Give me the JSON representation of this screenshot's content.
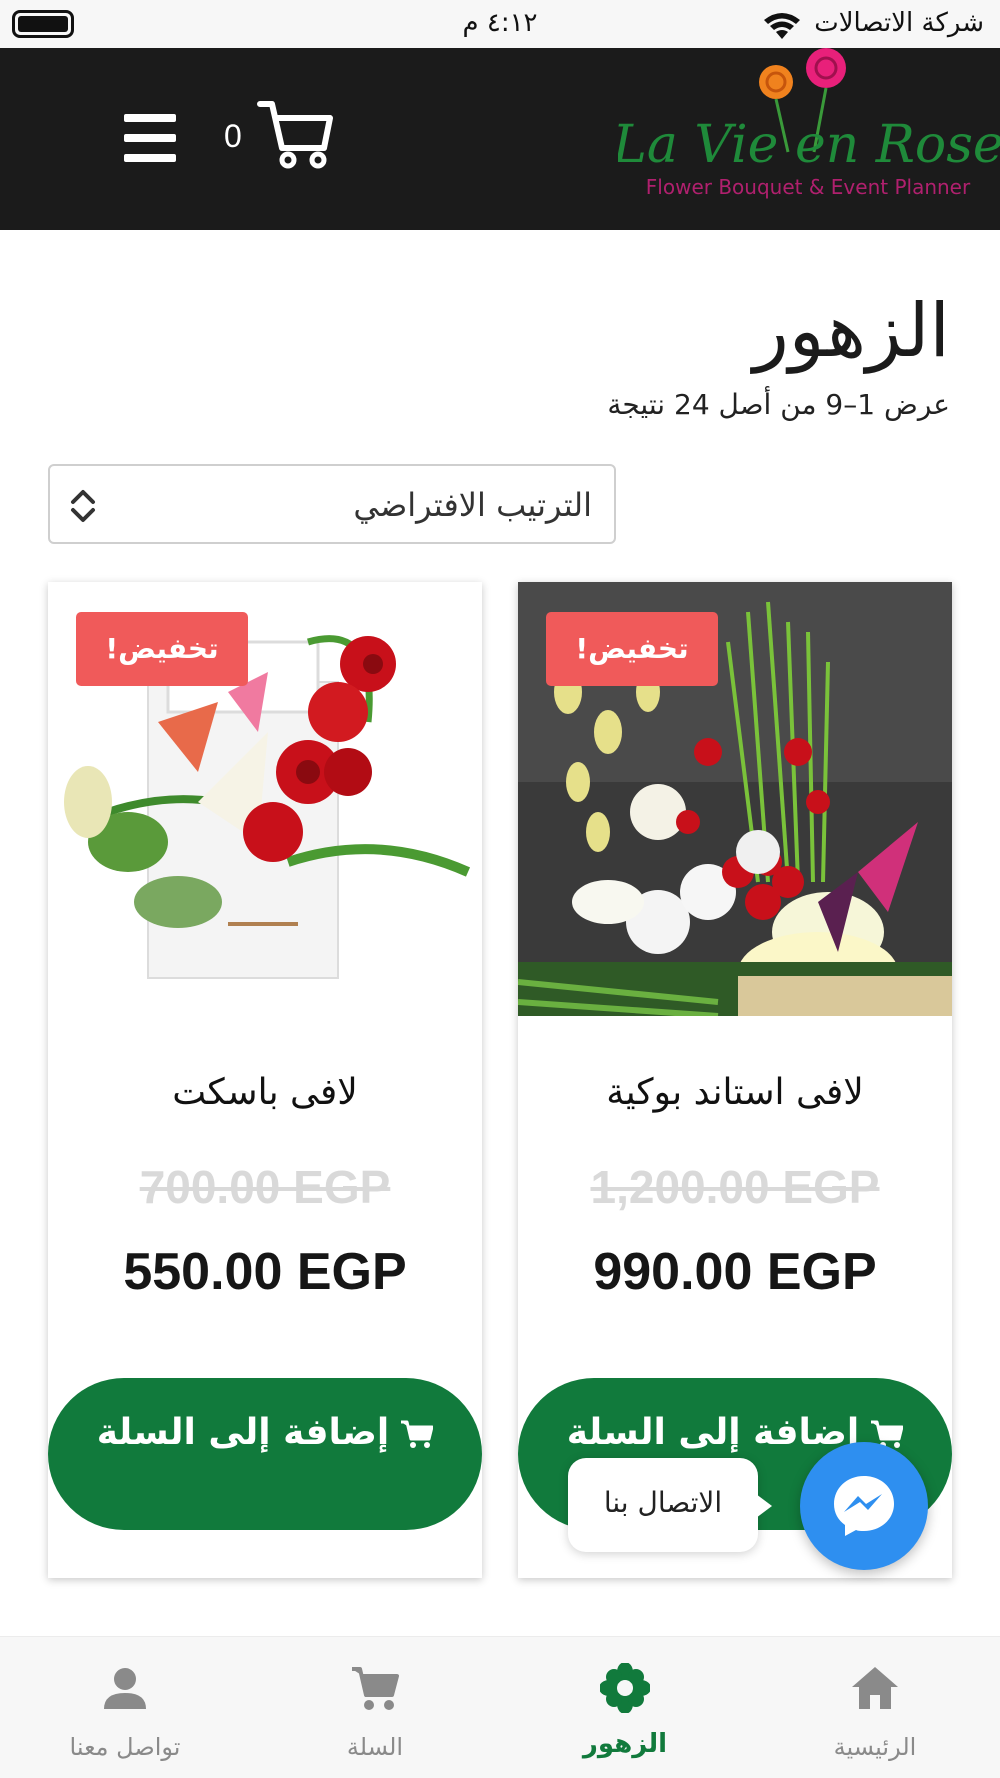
{
  "status_bar": {
    "time": "٤:١٢ م",
    "carrier": "شركة الاتصالات",
    "icons": [
      "battery-icon",
      "wifi-icon"
    ]
  },
  "header": {
    "cart_count": "0",
    "logo_title": "La Vie en Rose",
    "logo_subtitle": "Flower Bouquet & Event Planner",
    "icons": [
      "menu-icon",
      "cart-icon"
    ]
  },
  "page": {
    "title": "الزهور",
    "results": "عرض 1–9 من أصل 24 نتيجة"
  },
  "sort": {
    "selected": "الترتيب الافتراضي",
    "icon": "sort-arrows-icon"
  },
  "products": [
    {
      "badge": "تخفيض!",
      "name": "لافى باسكت",
      "old_price": "700.00 EGP",
      "new_price": "550.00 EGP",
      "button": "إضافة إلى السلة"
    },
    {
      "badge": "تخفيض!",
      "name": "لافى استاند بوكية",
      "old_price": "1,200.00 EGP",
      "new_price": "990.00 EGP",
      "button": "إضافة إلى السلة"
    }
  ],
  "chat": {
    "label": "الاتصال بنا",
    "icon": "messenger-icon"
  },
  "bottom_nav": {
    "items": [
      {
        "label": "تواصل معنا",
        "icon": "person-icon",
        "active": false
      },
      {
        "label": "السلة",
        "icon": "cart-icon",
        "active": false
      },
      {
        "label": "الزهور",
        "icon": "flower-icon",
        "active": true
      },
      {
        "label": "الرئيسية",
        "icon": "home-icon",
        "active": false
      }
    ]
  },
  "colors": {
    "header_bg": "#1b1b1b",
    "brand_green": "#117a3c",
    "sale_red": "#f05a5a",
    "messenger_blue": "#2e8ff0",
    "logo_green": "#1f8a3a",
    "logo_magenta": "#b0206e"
  }
}
